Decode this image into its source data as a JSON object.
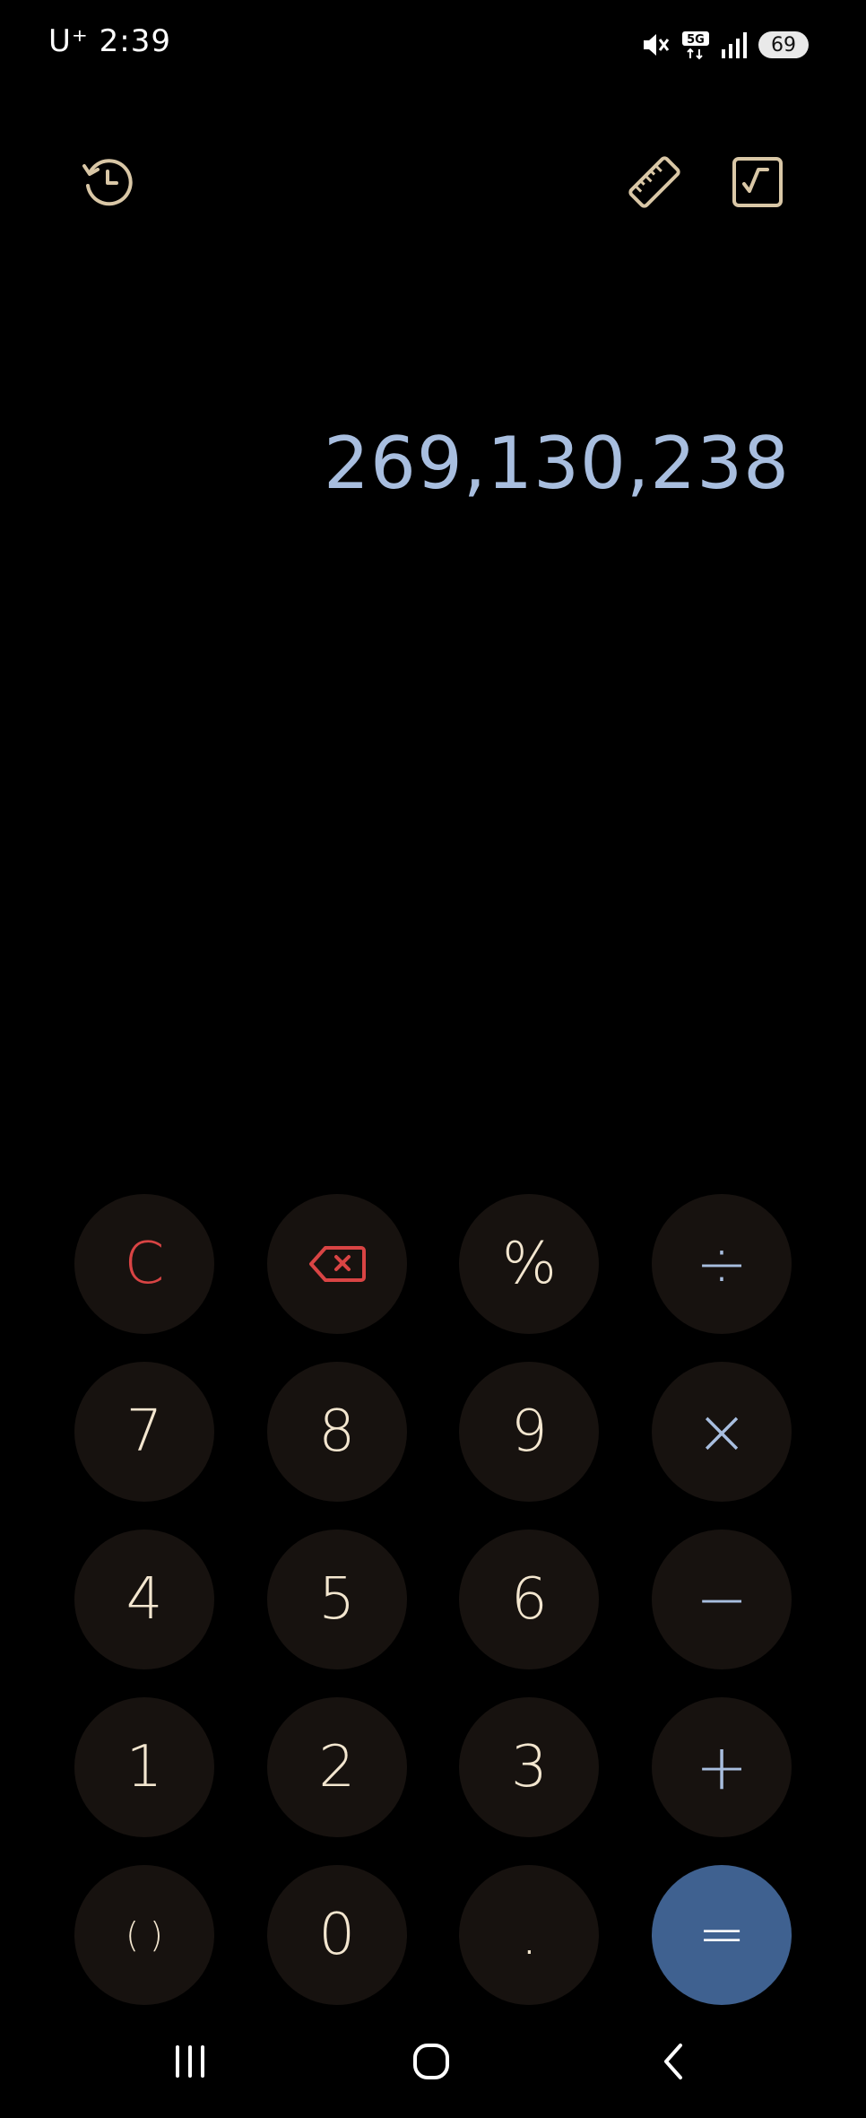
{
  "status_bar": {
    "carrier_time": "U⁺ 2:39",
    "network": "5G",
    "battery": "69",
    "icons": [
      "mute-icon",
      "5g-icon",
      "signal-icon",
      "battery-icon"
    ]
  },
  "toolbar": {
    "icons": [
      "history-icon",
      "ruler-icon",
      "scientific-icon"
    ]
  },
  "display": {
    "value": "269,130,238"
  },
  "keypad": {
    "clear": "C",
    "backspace_icon": "backspace-icon",
    "percent": "%",
    "divide": "÷",
    "seven": "7",
    "eight": "8",
    "nine": "9",
    "multiply": "×",
    "four": "4",
    "five": "5",
    "six": "6",
    "minus": "−",
    "one": "1",
    "two": "2",
    "three": "3",
    "plus": "+",
    "parentheses": "( )",
    "zero": "0",
    "decimal": ".",
    "equals": "="
  },
  "colors": {
    "background": "#000000",
    "key_background": "#17120f",
    "digit": "#f3e6cf",
    "operator": "#a8bedf",
    "clear": "#d94444",
    "equals_background": "#3f6190",
    "display_text": "#a8bedf",
    "icon": "#d9c7a6"
  }
}
